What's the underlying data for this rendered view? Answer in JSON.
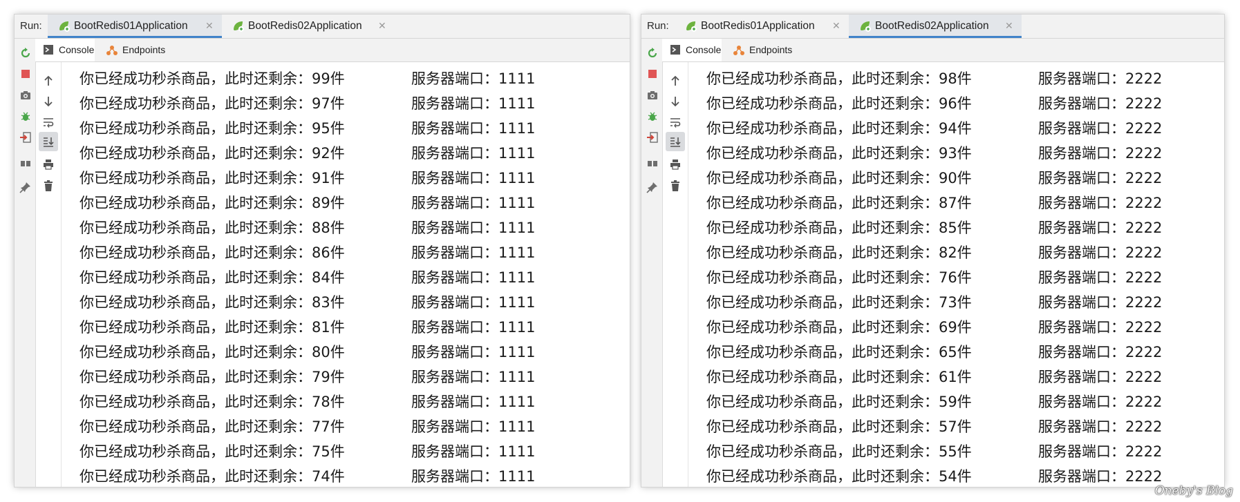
{
  "colors": {
    "accent_tab_underline": "#4083c9",
    "stop_red": "#e05555",
    "rerun_green": "#4aa64a",
    "spring_green": "#6db33f",
    "endpoint_orange": "#e8843a"
  },
  "watermark": "Oneby's Blog",
  "panes": [
    {
      "run_label": "Run:",
      "run_tabs": [
        {
          "label": "BootRedis01Application",
          "active": true,
          "icon": "spring-boot-icon"
        },
        {
          "label": "BootRedis02Application",
          "active": false,
          "icon": "spring-boot-icon"
        }
      ],
      "sub_tabs": [
        {
          "label": "Console",
          "active": true,
          "icon": "console-icon"
        },
        {
          "label": "Endpoints",
          "active": false,
          "icon": "endpoints-icon"
        }
      ],
      "lines": [
        {
          "message": "你已经成功秒杀商品，此时还剩余：99件",
          "port_label": "服务器端口：",
          "port": "1111"
        },
        {
          "message": "你已经成功秒杀商品，此时还剩余：97件",
          "port_label": "服务器端口：",
          "port": "1111"
        },
        {
          "message": "你已经成功秒杀商品，此时还剩余：95件",
          "port_label": "服务器端口：",
          "port": "1111"
        },
        {
          "message": "你已经成功秒杀商品，此时还剩余：92件",
          "port_label": "服务器端口：",
          "port": "1111"
        },
        {
          "message": "你已经成功秒杀商品，此时还剩余：91件",
          "port_label": "服务器端口：",
          "port": "1111"
        },
        {
          "message": "你已经成功秒杀商品，此时还剩余：89件",
          "port_label": "服务器端口：",
          "port": "1111"
        },
        {
          "message": "你已经成功秒杀商品，此时还剩余：88件",
          "port_label": "服务器端口：",
          "port": "1111"
        },
        {
          "message": "你已经成功秒杀商品，此时还剩余：86件",
          "port_label": "服务器端口：",
          "port": "1111"
        },
        {
          "message": "你已经成功秒杀商品，此时还剩余：84件",
          "port_label": "服务器端口：",
          "port": "1111"
        },
        {
          "message": "你已经成功秒杀商品，此时还剩余：83件",
          "port_label": "服务器端口：",
          "port": "1111"
        },
        {
          "message": "你已经成功秒杀商品，此时还剩余：81件",
          "port_label": "服务器端口：",
          "port": "1111"
        },
        {
          "message": "你已经成功秒杀商品，此时还剩余：80件",
          "port_label": "服务器端口：",
          "port": "1111"
        },
        {
          "message": "你已经成功秒杀商品，此时还剩余：79件",
          "port_label": "服务器端口：",
          "port": "1111"
        },
        {
          "message": "你已经成功秒杀商品，此时还剩余：78件",
          "port_label": "服务器端口：",
          "port": "1111"
        },
        {
          "message": "你已经成功秒杀商品，此时还剩余：77件",
          "port_label": "服务器端口：",
          "port": "1111"
        },
        {
          "message": "你已经成功秒杀商品，此时还剩余：75件",
          "port_label": "服务器端口：",
          "port": "1111"
        },
        {
          "message": "你已经成功秒杀商品，此时还剩余：74件",
          "port_label": "服务器端口：",
          "port": "1111"
        }
      ]
    },
    {
      "run_label": "Run:",
      "run_tabs": [
        {
          "label": "BootRedis01Application",
          "active": false,
          "icon": "spring-boot-icon"
        },
        {
          "label": "BootRedis02Application",
          "active": true,
          "icon": "spring-boot-icon"
        }
      ],
      "sub_tabs": [
        {
          "label": "Console",
          "active": true,
          "icon": "console-icon"
        },
        {
          "label": "Endpoints",
          "active": false,
          "icon": "endpoints-icon"
        }
      ],
      "lines": [
        {
          "message": "你已经成功秒杀商品，此时还剩余：98件",
          "port_label": "服务器端口：",
          "port": "2222"
        },
        {
          "message": "你已经成功秒杀商品，此时还剩余：96件",
          "port_label": "服务器端口：",
          "port": "2222"
        },
        {
          "message": "你已经成功秒杀商品，此时还剩余：94件",
          "port_label": "服务器端口：",
          "port": "2222"
        },
        {
          "message": "你已经成功秒杀商品，此时还剩余：93件",
          "port_label": "服务器端口：",
          "port": "2222"
        },
        {
          "message": "你已经成功秒杀商品，此时还剩余：90件",
          "port_label": "服务器端口：",
          "port": "2222"
        },
        {
          "message": "你已经成功秒杀商品，此时还剩余：87件",
          "port_label": "服务器端口：",
          "port": "2222"
        },
        {
          "message": "你已经成功秒杀商品，此时还剩余：85件",
          "port_label": "服务器端口：",
          "port": "2222"
        },
        {
          "message": "你已经成功秒杀商品，此时还剩余：82件",
          "port_label": "服务器端口：",
          "port": "2222"
        },
        {
          "message": "你已经成功秒杀商品，此时还剩余：76件",
          "port_label": "服务器端口：",
          "port": "2222"
        },
        {
          "message": "你已经成功秒杀商品，此时还剩余：73件",
          "port_label": "服务器端口：",
          "port": "2222"
        },
        {
          "message": "你已经成功秒杀商品，此时还剩余：69件",
          "port_label": "服务器端口：",
          "port": "2222"
        },
        {
          "message": "你已经成功秒杀商品，此时还剩余：65件",
          "port_label": "服务器端口：",
          "port": "2222"
        },
        {
          "message": "你已经成功秒杀商品，此时还剩余：61件",
          "port_label": "服务器端口：",
          "port": "2222"
        },
        {
          "message": "你已经成功秒杀商品，此时还剩余：59件",
          "port_label": "服务器端口：",
          "port": "2222"
        },
        {
          "message": "你已经成功秒杀商品，此时还剩余：57件",
          "port_label": "服务器端口：",
          "port": "2222"
        },
        {
          "message": "你已经成功秒杀商品，此时还剩余：55件",
          "port_label": "服务器端口：",
          "port": "2222"
        },
        {
          "message": "你已经成功秒杀商品，此时还剩余：54件",
          "port_label": "服务器端口：",
          "port": "2222"
        }
      ]
    }
  ]
}
